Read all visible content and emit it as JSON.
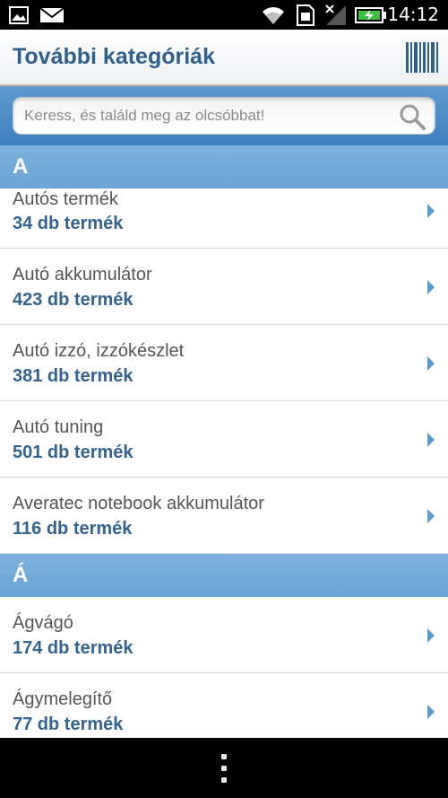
{
  "status_bar": {
    "time": "14:12",
    "icons": [
      "image-icon",
      "mail-icon",
      "wifi-icon",
      "sim-icon",
      "signal-icon",
      "battery-charging-icon"
    ]
  },
  "header": {
    "title": "További kategóriák",
    "barcode_icon": "barcode-icon"
  },
  "search": {
    "placeholder": "Keress, és találd meg az olcsóbbat!",
    "value": "",
    "icon": "search-icon"
  },
  "sections": [
    {
      "letter": "A",
      "items": [
        {
          "name": "Autós termék",
          "count": "34 db termék"
        },
        {
          "name": "Autó akkumulátor",
          "count": "423 db termék"
        },
        {
          "name": "Autó izzó, izzókészlet",
          "count": "381 db termék"
        },
        {
          "name": "Autó tuning",
          "count": "501 db termék"
        },
        {
          "name": "Averatec notebook akkumulátor",
          "count": "116 db termék"
        }
      ]
    },
    {
      "letter": "Á",
      "items": [
        {
          "name": "Ágvágó",
          "count": "174 db termék"
        },
        {
          "name": "Ágymelegítő",
          "count": "77 db termék"
        }
      ]
    }
  ],
  "colors": {
    "accent": "#2f5f8c",
    "section_header": "#6aa3d5",
    "count_text": "#33638f",
    "chevron": "#5b9ad0"
  }
}
